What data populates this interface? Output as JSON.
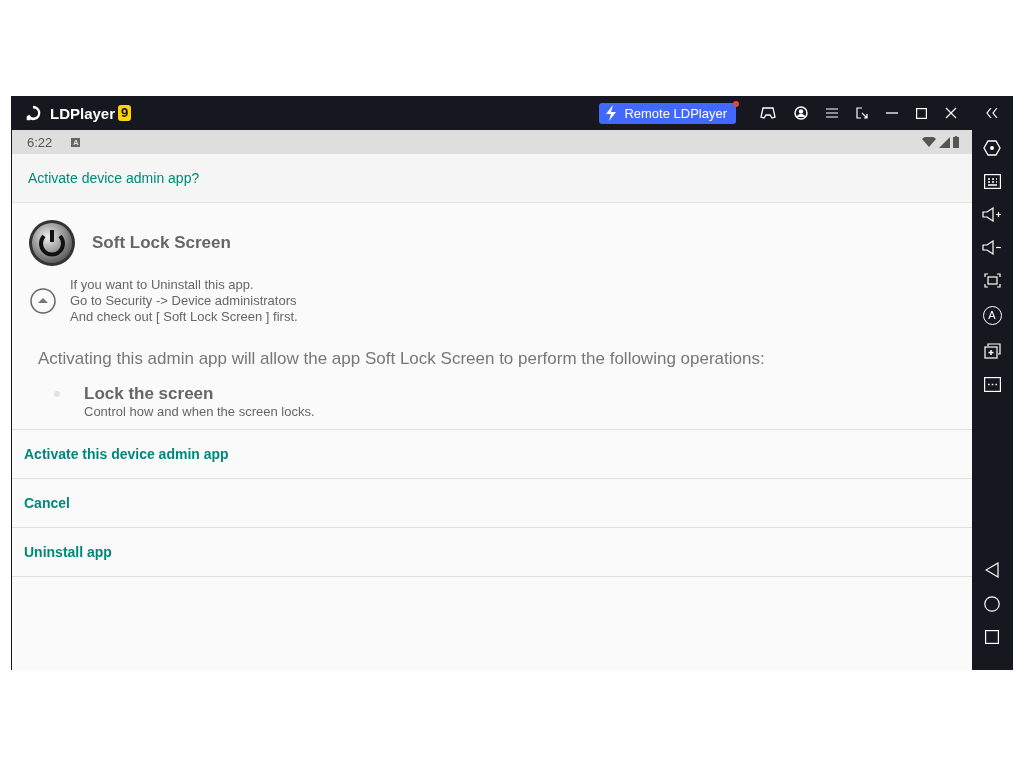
{
  "window": {
    "title": "LDPlayer",
    "version_badge": "9",
    "remote_button": {
      "label": "Remote LDPlayer",
      "notification": true
    }
  },
  "status_bar": {
    "time": "6:22",
    "notification_letter": "A"
  },
  "dialog": {
    "title": "Activate device admin app?",
    "app_name": "Soft Lock Screen",
    "uninstall_note": [
      "If you want to Uninstall this app.",
      "Go to Security -> Device administrators",
      "And check out [ Soft Lock Screen ] first."
    ],
    "description": "Activating this admin app will allow the app Soft Lock Screen to perform the following operations:",
    "policies": [
      {
        "title": "Lock the screen",
        "summary": "Control how and when the screen locks."
      }
    ],
    "actions": [
      "Activate this device admin app",
      "Cancel",
      "Uninstall app"
    ]
  },
  "sidebar": {
    "tools": [
      {
        "kind": "settings"
      },
      {
        "kind": "keyboard"
      },
      {
        "kind": "volume-up"
      },
      {
        "kind": "volume-down"
      },
      {
        "kind": "screenshot"
      },
      {
        "kind": "rotate",
        "label": "A"
      },
      {
        "kind": "multi-instance"
      },
      {
        "kind": "more"
      }
    ],
    "nav": [
      {
        "kind": "back"
      },
      {
        "kind": "home"
      },
      {
        "kind": "recents"
      }
    ]
  }
}
